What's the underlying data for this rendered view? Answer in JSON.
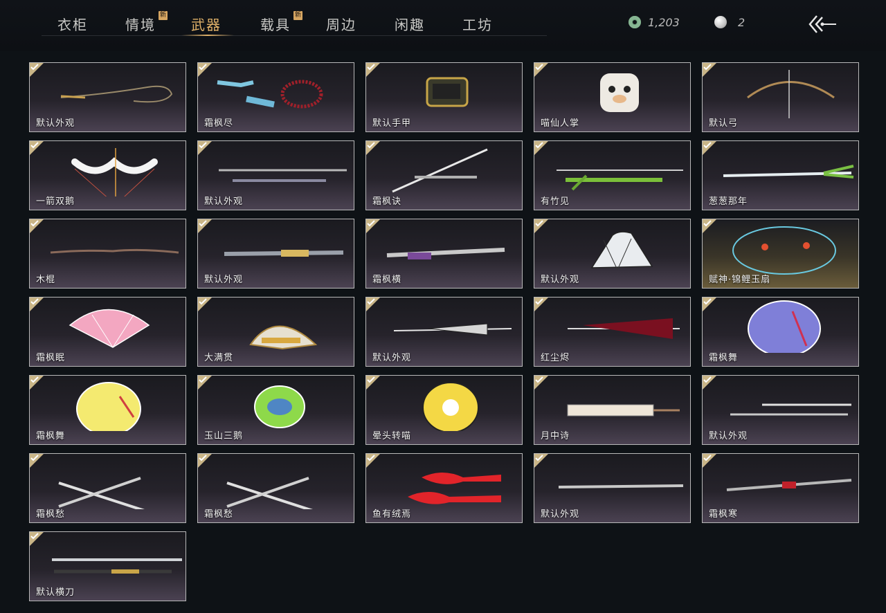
{
  "nav": {
    "tabs": [
      {
        "label": "衣柜",
        "is_new": false,
        "active": false
      },
      {
        "label": "情境",
        "is_new": true,
        "active": false
      },
      {
        "label": "武器",
        "is_new": false,
        "active": true
      },
      {
        "label": "载具",
        "is_new": true,
        "active": false
      },
      {
        "label": "周边",
        "is_new": false,
        "active": false
      },
      {
        "label": "闲趣",
        "is_new": false,
        "active": false
      },
      {
        "label": "工坊",
        "is_new": false,
        "active": false
      }
    ],
    "new_badge": "新"
  },
  "currency": {
    "jade_amount": "1,203",
    "pearl_amount": "2"
  },
  "items": [
    {
      "name": "默认外观",
      "art": "whip-icon",
      "owned": true
    },
    {
      "name": "霜枫尽",
      "art": "meteor-hammer-icon",
      "owned": true
    },
    {
      "name": "默认手甲",
      "art": "gauntlet-icon",
      "owned": true
    },
    {
      "name": "喵仙人掌",
      "art": "cat-paw-icon",
      "owned": true
    },
    {
      "name": "默认弓",
      "art": "bow-icon",
      "owned": true
    },
    {
      "name": "一箭双鹅",
      "art": "goose-bow-icon",
      "owned": true
    },
    {
      "name": "默认外观",
      "art": "spear-icon",
      "owned": true
    },
    {
      "name": "霜枫诀",
      "art": "sword-icon",
      "owned": true
    },
    {
      "name": "有竹见",
      "art": "bamboo-spear-icon",
      "owned": true
    },
    {
      "name": "葱葱那年",
      "art": "scallion-spear-icon",
      "owned": true
    },
    {
      "name": "木棍",
      "art": "wood-staff-icon",
      "owned": true
    },
    {
      "name": "默认外观",
      "art": "blade-staff-icon",
      "owned": true
    },
    {
      "name": "霜枫横",
      "art": "purple-blade-icon",
      "owned": true
    },
    {
      "name": "默认外观",
      "art": "fan-icon",
      "owned": true
    },
    {
      "name": "赋神·锦鲤玉扇",
      "art": "koi-fan-icon",
      "owned": true,
      "gold": true
    },
    {
      "name": "霜枫眠",
      "art": "pink-fan-icon",
      "owned": true
    },
    {
      "name": "大满贯",
      "art": "mahjong-fan-icon",
      "owned": true
    },
    {
      "name": "默认外观",
      "art": "closed-umbrella-icon",
      "owned": true
    },
    {
      "name": "红尘烬",
      "art": "red-umbrella-icon",
      "owned": true
    },
    {
      "name": "霜枫舞",
      "art": "purple-umbrella-icon",
      "owned": true
    },
    {
      "name": "霜枫舞",
      "art": "yellow-umbrella-icon",
      "owned": true
    },
    {
      "name": "玉山三鹅",
      "art": "green-umbrella-icon",
      "owned": true
    },
    {
      "name": "晕头转喵",
      "art": "cat-umbrella-icon",
      "owned": true
    },
    {
      "name": "月中诗",
      "art": "white-umbrella-icon",
      "owned": true
    },
    {
      "name": "默认外观",
      "art": "twin-swords-icon",
      "owned": true
    },
    {
      "name": "霜枫愁",
      "art": "crossed-blades-icon",
      "owned": true
    },
    {
      "name": "霜枫愁",
      "art": "crossed-blades-icon",
      "owned": true
    },
    {
      "name": "鱼有绒焉",
      "art": "fish-blades-icon",
      "owned": true
    },
    {
      "name": "默认外观",
      "art": "long-blade-icon",
      "owned": true
    },
    {
      "name": "霜枫寒",
      "art": "red-long-blade-icon",
      "owned": true
    },
    {
      "name": "默认横刀",
      "art": "dao-sword-icon",
      "owned": true
    }
  ]
}
